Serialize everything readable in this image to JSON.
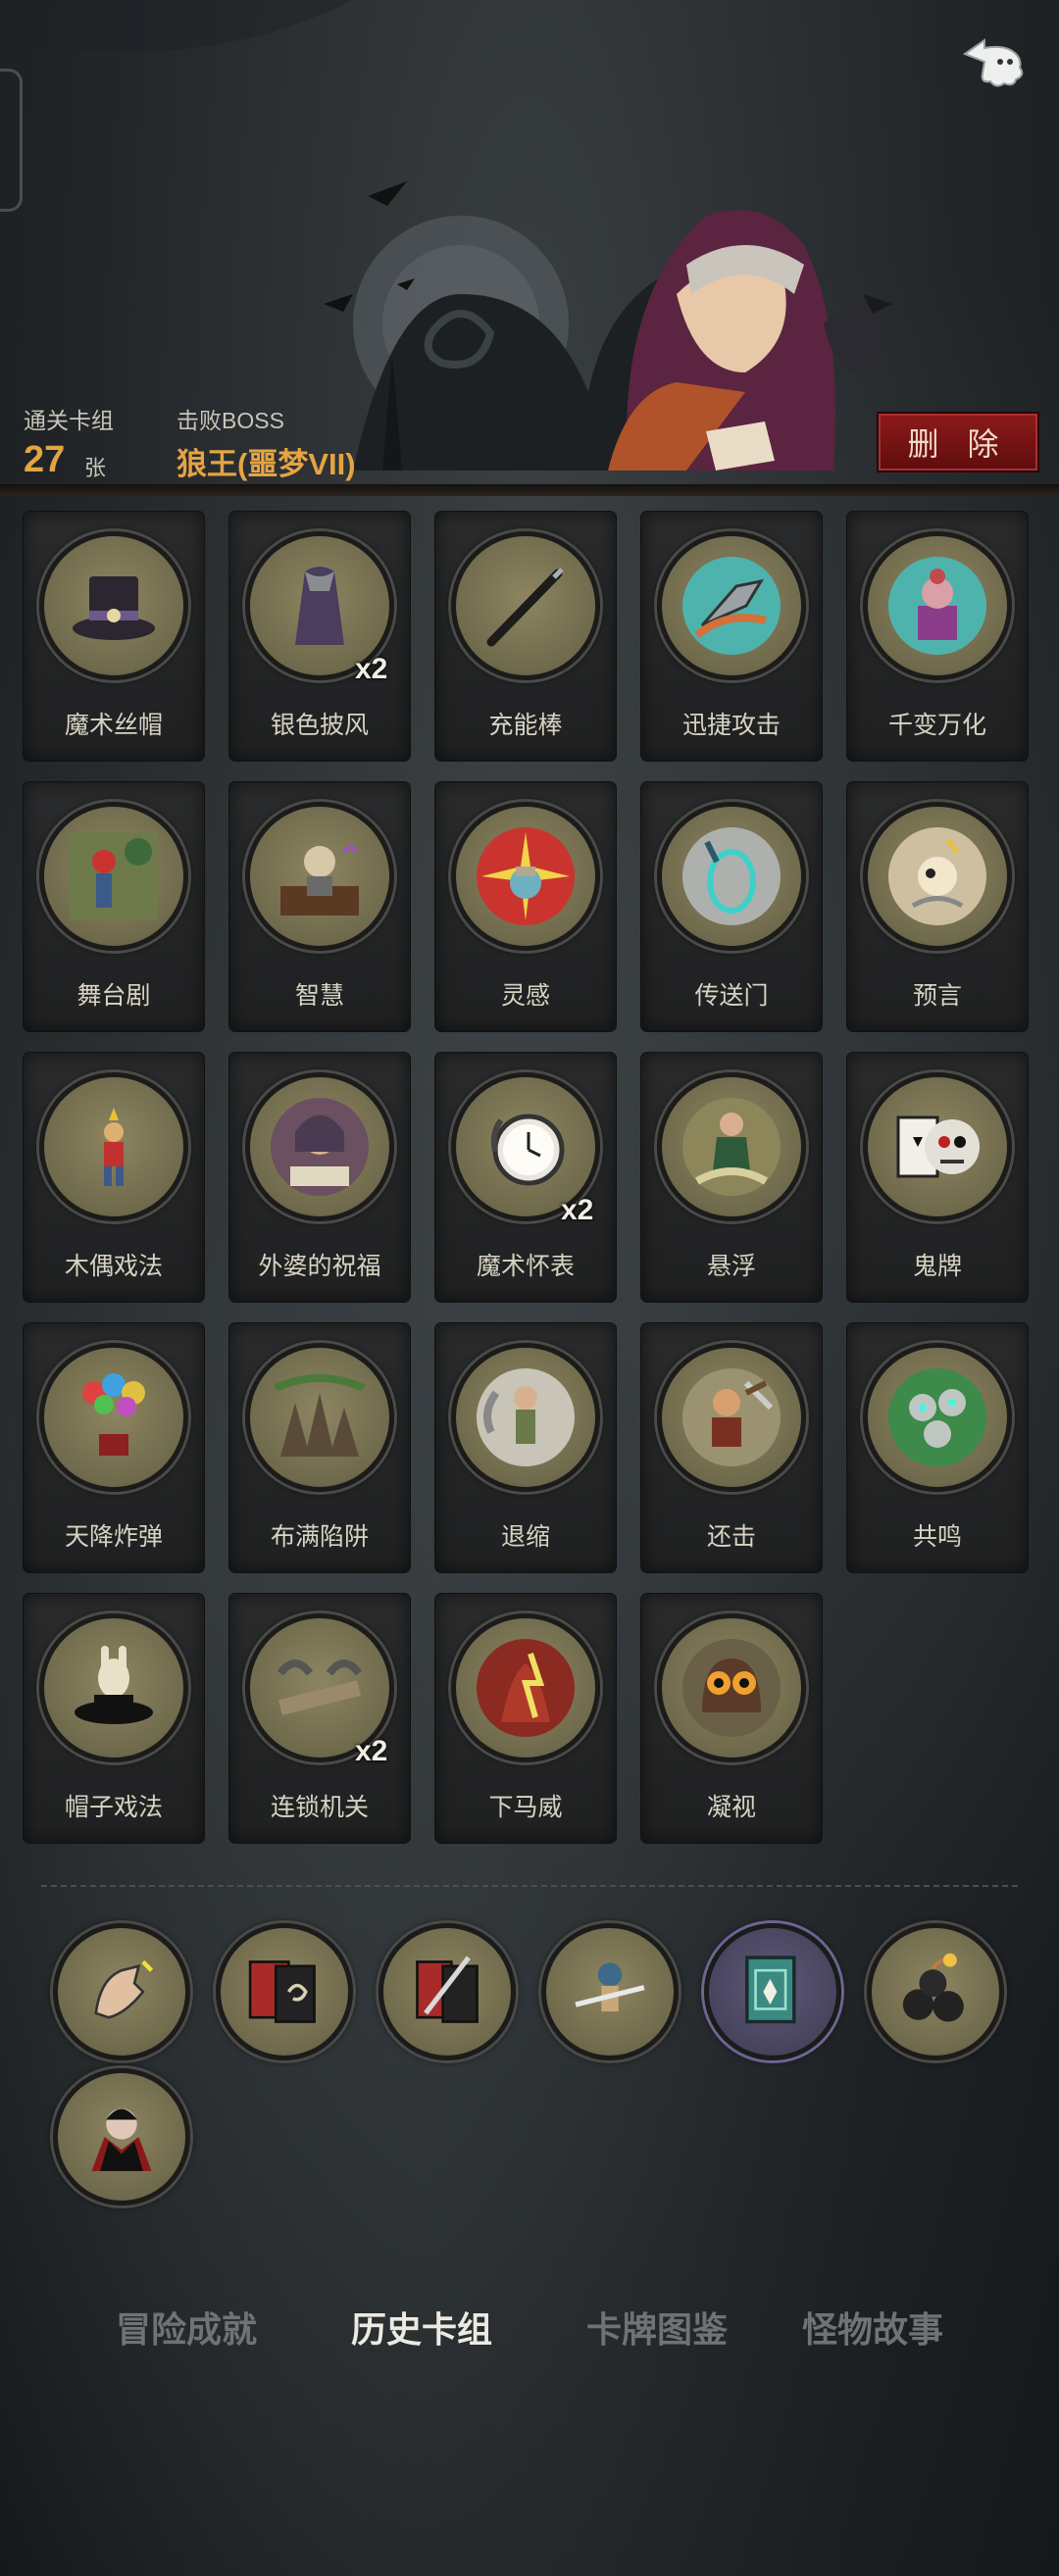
{
  "header": {
    "deck_label": "通关卡组",
    "deck_count": "27",
    "deck_unit": "张",
    "boss_label": "击败BOSS",
    "boss_name": "狼王(噩梦VII)",
    "delete_label": "删 除"
  },
  "cards": [
    {
      "label": "魔术丝帽",
      "icon": "top-hat-icon",
      "count": ""
    },
    {
      "label": "银色披风",
      "icon": "cloak-icon",
      "count": "x2"
    },
    {
      "label": "充能棒",
      "icon": "wand-icon",
      "count": ""
    },
    {
      "label": "迅捷攻击",
      "icon": "swift-attack-icon",
      "count": ""
    },
    {
      "label": "千变万化",
      "icon": "transform-icon",
      "count": ""
    },
    {
      "label": "舞台剧",
      "icon": "stage-play-icon",
      "count": ""
    },
    {
      "label": "智慧",
      "icon": "wisdom-icon",
      "count": ""
    },
    {
      "label": "灵感",
      "icon": "inspiration-icon",
      "count": ""
    },
    {
      "label": "传送门",
      "icon": "portal-icon",
      "count": ""
    },
    {
      "label": "预言",
      "icon": "prophecy-icon",
      "count": ""
    },
    {
      "label": "木偶戏法",
      "icon": "puppet-icon",
      "count": ""
    },
    {
      "label": "外婆的祝福",
      "icon": "grandma-icon",
      "count": ""
    },
    {
      "label": "魔术怀表",
      "icon": "pocket-watch-icon",
      "count": "x2"
    },
    {
      "label": "悬浮",
      "icon": "levitate-icon",
      "count": ""
    },
    {
      "label": "鬼牌",
      "icon": "joker-card-icon",
      "count": ""
    },
    {
      "label": "天降炸弹",
      "icon": "balloon-bomb-icon",
      "count": ""
    },
    {
      "label": "布满陷阱",
      "icon": "spike-trap-icon",
      "count": ""
    },
    {
      "label": "退缩",
      "icon": "retreat-icon",
      "count": ""
    },
    {
      "label": "还击",
      "icon": "counter-attack-icon",
      "count": ""
    },
    {
      "label": "共鸣",
      "icon": "resonance-icon",
      "count": ""
    },
    {
      "label": "帽子戏法",
      "icon": "rabbit-hat-icon",
      "count": ""
    },
    {
      "label": "连锁机关",
      "icon": "chain-trap-icon",
      "count": "x2"
    },
    {
      "label": "下马威",
      "icon": "intimidate-icon",
      "count": ""
    },
    {
      "label": "凝视",
      "icon": "owl-gaze-icon",
      "count": ""
    }
  ],
  "relics": [
    {
      "icon": "magic-hand-icon"
    },
    {
      "icon": "card-spiral-icon"
    },
    {
      "icon": "card-dagger-icon"
    },
    {
      "icon": "puppet-strike-icon"
    },
    {
      "icon": "spellbook-icon",
      "purple": true
    },
    {
      "icon": "bomb-pile-icon"
    },
    {
      "icon": "vampire-icon"
    }
  ],
  "tabs": [
    {
      "label": "冒险成就",
      "active": false
    },
    {
      "label": "历史卡组",
      "active": true
    },
    {
      "label": "卡牌图鉴",
      "active": false
    },
    {
      "label": "怪物故事",
      "active": false
    }
  ],
  "colors": {
    "accent": "#e5a443",
    "delete": "#8e1a1a",
    "medal": "#7d7656"
  }
}
